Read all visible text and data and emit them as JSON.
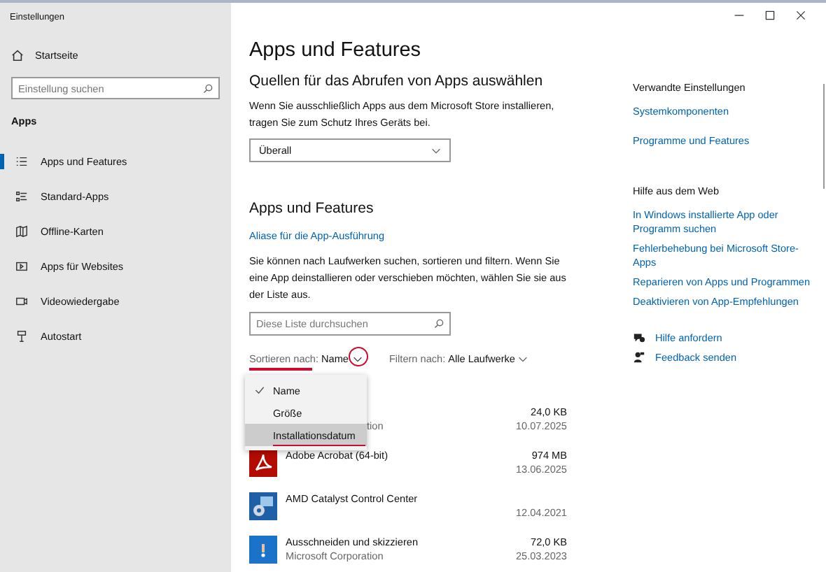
{
  "window": {
    "title": "Einstellungen"
  },
  "sidebar": {
    "home": "Startseite",
    "search": {
      "placeholder": "Einstellung suchen"
    },
    "section": "Apps",
    "items": [
      {
        "label": "Apps und Features",
        "kind": "list",
        "selected": true
      },
      {
        "label": "Standard-Apps",
        "kind": "defaults",
        "selected": false
      },
      {
        "label": "Offline-Karten",
        "kind": "map",
        "selected": false
      },
      {
        "label": "Apps für Websites",
        "kind": "web",
        "selected": false
      },
      {
        "label": "Videowiedergabe",
        "kind": "video",
        "selected": false
      },
      {
        "label": "Autostart",
        "kind": "startup",
        "selected": false
      }
    ]
  },
  "main": {
    "title": "Apps und Features",
    "sources": {
      "heading": "Quellen für das Abrufen von Apps auswählen",
      "text": "Wenn Sie ausschließlich Apps aus dem Microsoft Store installieren, tragen Sie zum Schutz Ihres Geräts bei.",
      "value": "Überall"
    },
    "section": "Apps und Features",
    "alias_link": "Aliase für die App-Ausführung",
    "description": "Sie können nach Laufwerken suchen, sortieren und filtern. Wenn Sie eine App deinstallieren oder verschieben möchten, wählen Sie sie aus der Liste aus.",
    "search": {
      "placeholder": "Diese Liste durchsuchen"
    },
    "sort": {
      "label": "Sortieren nach:",
      "value": "Name"
    },
    "filter": {
      "label": "Filtern nach:",
      "value": "Alle Laufwerke"
    },
    "sort_menu": [
      {
        "label": "Name",
        "selected": true,
        "hovered": false
      },
      {
        "label": "Größe",
        "selected": false,
        "hovered": false
      },
      {
        "label": "Installationsdatum",
        "selected": false,
        "hovered": true
      }
    ],
    "apps": [
      {
        "publisher": "tion",
        "size": "24,0 KB",
        "date": "10.07.2025"
      },
      {
        "kind": "acrobat",
        "name": "Adobe Acrobat (64-bit)",
        "size": "974 MB",
        "date": "13.06.2025"
      },
      {
        "kind": "amd",
        "name": "AMD Catalyst Control Center",
        "date": "12.04.2021"
      },
      {
        "kind": "snip",
        "name": "Ausschneiden und skizzieren",
        "publisher": "Microsoft Corporation",
        "size": "72,0 KB",
        "date": "25.03.2023"
      }
    ]
  },
  "related": {
    "heading": "Verwandte Einstellungen",
    "links": [
      "Systemkomponenten",
      "Programme und Features"
    ]
  },
  "web_help": {
    "heading": "Hilfe aus dem Web",
    "links": [
      "In Windows installierte App oder Programm suchen",
      "Fehlerbehebung bei Microsoft Store-Apps",
      "Reparieren von Apps und Programmen",
      "Deaktivieren von App-Empfehlungen"
    ]
  },
  "help_actions": [
    {
      "label": "Hilfe anfordern",
      "kind": "help"
    },
    {
      "label": "Feedback senden",
      "kind": "feedback"
    }
  ]
}
